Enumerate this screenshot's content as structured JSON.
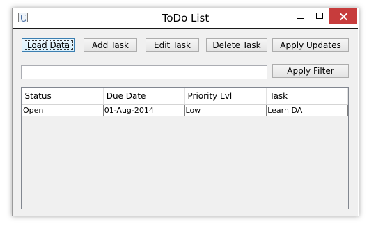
{
  "window": {
    "title": "ToDo List"
  },
  "toolbar": {
    "load_data": "Load Data",
    "add_task": "Add Task",
    "edit_task": "Edit Task",
    "delete_task": "Delete Task",
    "apply_updates": "Apply Updates",
    "apply_filter": "Apply Filter"
  },
  "filter": {
    "value": ""
  },
  "table": {
    "columns": [
      "Status",
      "Due Date",
      "Priority Lvl",
      "Task"
    ],
    "rows": [
      [
        "Open",
        "01-Aug-2014",
        "Low",
        "Learn DA"
      ]
    ]
  },
  "colors": {
    "close_button": "#c73c3c",
    "focus_border": "#3c7fb1"
  },
  "icons": {
    "app": "java-cup-icon",
    "minimize": "minimize-icon",
    "maximize": "maximize-icon",
    "close": "close-icon"
  }
}
